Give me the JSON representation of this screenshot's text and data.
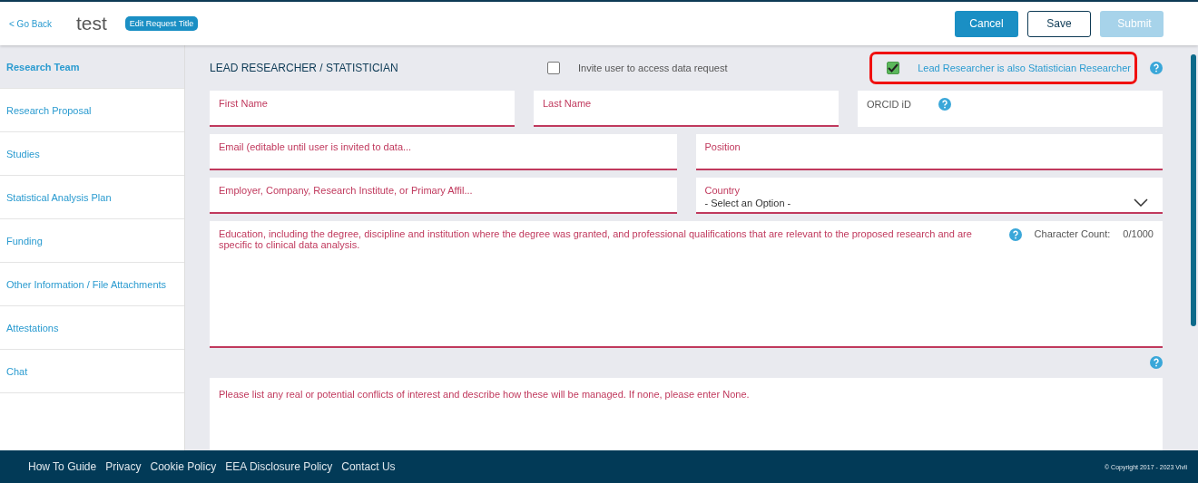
{
  "header": {
    "back_link": "< Go Back",
    "title": "test",
    "edit_title_button": "Edit Request Title",
    "buttons": [
      {
        "label": "Cancel",
        "kind": "primary"
      },
      {
        "label": "Save",
        "kind": "outline"
      },
      {
        "label": "Submit",
        "kind": "disabled"
      }
    ]
  },
  "sidebar": {
    "items": [
      {
        "label": "Research Team",
        "selected": true
      },
      {
        "label": "Research Proposal",
        "selected": false
      },
      {
        "label": "Studies",
        "selected": false
      },
      {
        "label": "Statistical Analysis Plan",
        "selected": false
      },
      {
        "label": "Funding",
        "selected": false
      },
      {
        "label": "Other Information / File Attachments",
        "selected": false
      },
      {
        "label": "Attestations",
        "selected": false
      },
      {
        "label": "Chat",
        "selected": false
      }
    ]
  },
  "section": {
    "heading": "LEAD RESEARCHER / STATISTICIAN",
    "invite": {
      "label": "Invite user to access data request",
      "checked": false
    },
    "statistician": {
      "label": "Lead Researcher is also Statistician Researcher",
      "checked": true,
      "highlighted": true
    },
    "rows": [
      [
        {
          "kind": "text",
          "label": "First Name",
          "required": true
        },
        {
          "kind": "text",
          "label": "Last Name",
          "required": true
        },
        {
          "kind": "help",
          "label": "ORCID iD",
          "required": false
        }
      ],
      [
        {
          "kind": "text",
          "label": "Email (editable until user is invited to data...",
          "required": true
        },
        {
          "kind": "text",
          "label": "Position",
          "required": true
        }
      ],
      [
        {
          "kind": "text",
          "label": "Employer, Company, Research Institute, or Primary Affil...",
          "required": true
        },
        {
          "kind": "select",
          "label": "Country",
          "value": "- Select an Option -",
          "required": true
        }
      ]
    ],
    "education": {
      "label": "Education, including the degree, discipline and institution where the degree was granted, and professional qualifications that are relevant to the proposed research and are specific to clinical data analysis.",
      "count_label": "Character Count:",
      "count": "0/1000"
    },
    "conflicts": {
      "label": "Please list any real or potential conflicts of interest and describe how these will be managed. If none, please enter None."
    }
  },
  "footer": {
    "links": [
      "How To Guide",
      "Privacy",
      "Cookie Policy",
      "EEA Disclosure Policy",
      "Contact Us"
    ],
    "copyright": "© Copyright 2017 - 2023 Vivli"
  }
}
